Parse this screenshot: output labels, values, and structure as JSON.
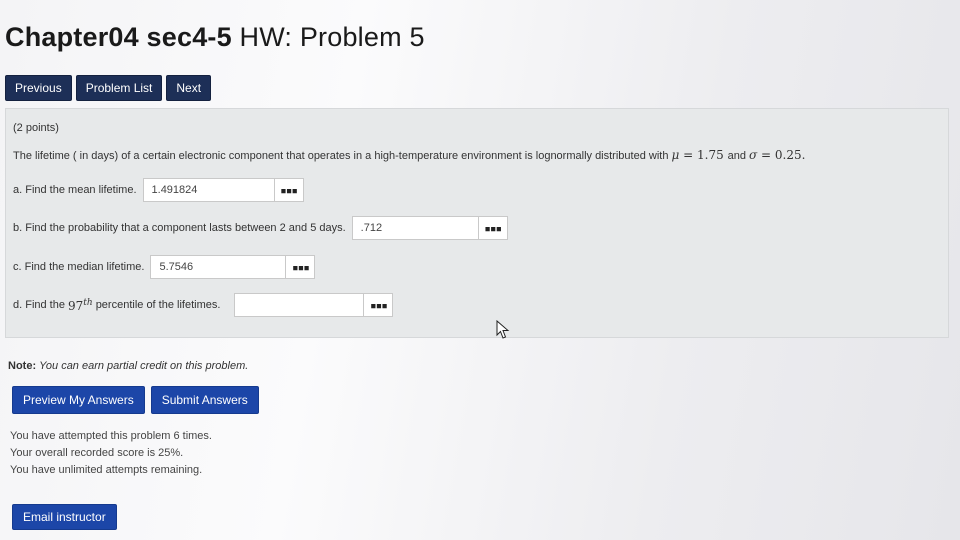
{
  "header": {
    "title_main": "Chapter04 sec4-5",
    "title_rest": "HW: Problem 5"
  },
  "nav": {
    "previous": "Previous",
    "problem_list": "Problem List",
    "next": "Next"
  },
  "problem": {
    "points": "(2 points)",
    "statement_prefix": "The lifetime ( in days) of a certain electronic component that operates in a high-temperature environment is lognormally distributed with",
    "mu_symbol": "μ",
    "mu_value": "1.75",
    "and_word": "and",
    "sigma_symbol": "σ",
    "sigma_value": "0.25",
    "parts": [
      {
        "label": "a. Find the mean lifetime.",
        "value": "1.491824"
      },
      {
        "label": "b. Find the probability that a component lasts between 2 and 5 days.",
        "value": ".712"
      },
      {
        "label": "c. Find the median lifetime.",
        "value": "5.7546"
      },
      {
        "label_prefix": "d. Find the",
        "label_math": "97",
        "label_sup": "th",
        "label_suffix": "percentile of the lifetimes.",
        "value": ""
      }
    ],
    "matrix_glyph": "▪▪▪"
  },
  "note": {
    "label": "Note:",
    "text": "You can earn partial credit on this problem."
  },
  "actions": {
    "preview": "Preview My Answers",
    "submit": "Submit Answers"
  },
  "attempts": {
    "line1": "You have attempted this problem 6 times.",
    "line2": "Your overall recorded score is 25%.",
    "line3": "You have unlimited attempts remaining."
  },
  "email": {
    "label": "Email instructor"
  },
  "colors": {
    "nav_button": "#1d2f57",
    "action_button": "#1c46a8",
    "problem_bg": "#e7e9ea"
  }
}
